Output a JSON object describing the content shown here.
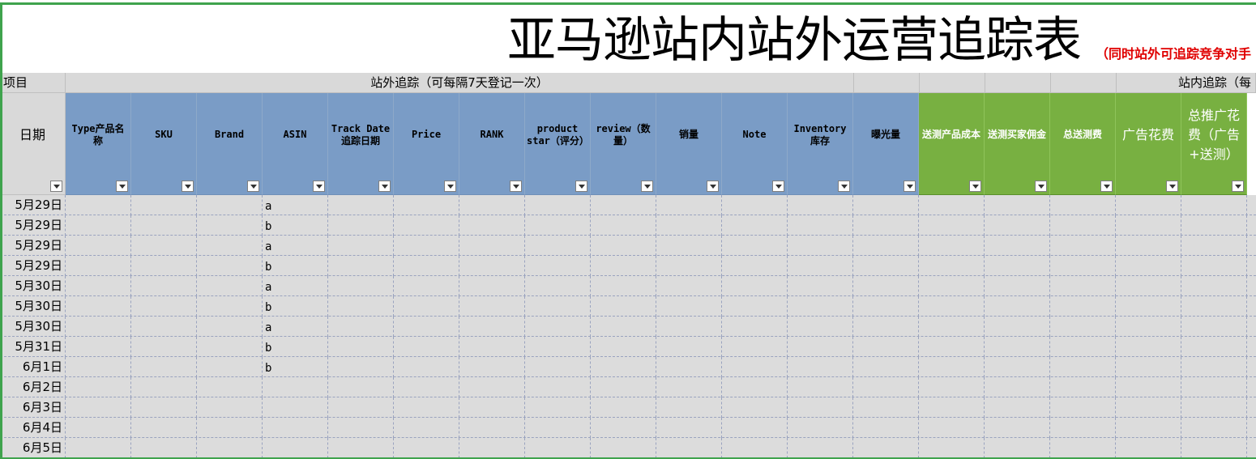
{
  "title": "亚马逊站内站外运营追踪表",
  "subtitle": "（同时站外可追踪竞争对手",
  "section_row": {
    "item_label": "项目",
    "offsite_label": "站外追踪（可每隔7天登记一次）",
    "onsite_label": "站内追踪（每"
  },
  "columns": [
    {
      "label": "日期",
      "style": "date"
    },
    {
      "label": "Type产品名称",
      "style": "blue"
    },
    {
      "label": "SKU",
      "style": "blue"
    },
    {
      "label": "Brand",
      "style": "blue"
    },
    {
      "label": "ASIN",
      "style": "blue"
    },
    {
      "label": "Track Date追踪日期",
      "style": "blue"
    },
    {
      "label": "Price",
      "style": "blue"
    },
    {
      "label": "RANK",
      "style": "blue"
    },
    {
      "label": "product star（评分）",
      "style": "blue"
    },
    {
      "label": "review（数量）",
      "style": "blue"
    },
    {
      "label": "销量",
      "style": "blue"
    },
    {
      "label": "Note",
      "style": "blue"
    },
    {
      "label": "Inventory 库存",
      "style": "blue"
    },
    {
      "label": "曝光量",
      "style": "blue"
    },
    {
      "label": "送测产品成本",
      "style": "green"
    },
    {
      "label": "送测买家佣金",
      "style": "green"
    },
    {
      "label": "总送测费",
      "style": "green"
    },
    {
      "label": "广告花费",
      "style": "green-big"
    },
    {
      "label": "总推广花费（广告+送测）",
      "style": "green-big"
    }
  ],
  "rows": [
    {
      "date": "5月29日",
      "asin": "a"
    },
    {
      "date": "5月29日",
      "asin": "b"
    },
    {
      "date": "5月29日",
      "asin": "a"
    },
    {
      "date": "5月29日",
      "asin": "b"
    },
    {
      "date": "5月30日",
      "asin": "a"
    },
    {
      "date": "5月30日",
      "asin": "b"
    },
    {
      "date": "5月30日",
      "asin": "a"
    },
    {
      "date": "5月31日",
      "asin": "b"
    },
    {
      "date": "6月1日",
      "asin": "b"
    },
    {
      "date": "6月2日",
      "asin": ""
    },
    {
      "date": "6月3日",
      "asin": ""
    },
    {
      "date": "6月4日",
      "asin": ""
    },
    {
      "date": "6月5日",
      "asin": ""
    }
  ],
  "colors": {
    "header_blue": "#7a9cc6",
    "header_green": "#78b041",
    "grid_gray": "#dcdcdc",
    "subtitle_red": "#e00000",
    "frame_green": "#3fa34d"
  }
}
